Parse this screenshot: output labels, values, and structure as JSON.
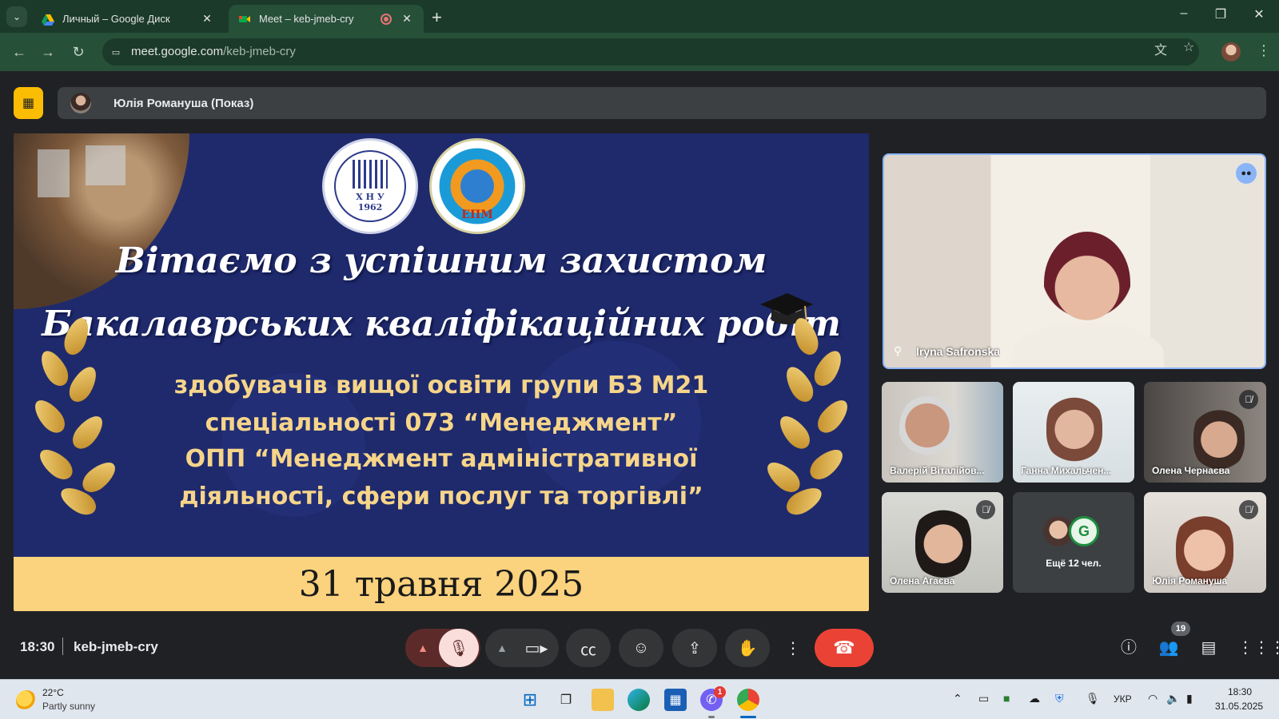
{
  "browser": {
    "tabs": [
      {
        "title": "Личный – Google Диск",
        "favicon": "google-drive-icon",
        "active": false
      },
      {
        "title": "Meet – keb-jmeb-cry",
        "favicon": "google-meet-icon",
        "active": true,
        "recording": true
      }
    ],
    "url_host": "meet.google.com",
    "url_path": "/keb-jmeb-cry",
    "accent": "#265038",
    "tabbar_color": "#1b3a2a"
  },
  "meet": {
    "presenter_label": "Юлія Романуша (Показ)",
    "slide": {
      "title_line1": "Вітаємо з успішним захистом",
      "title_line2": "Бакалаврських кваліфікаційних робіт",
      "sub_line1": "здобувачів вищої освіти групи БЗ М21",
      "sub_line2": "спеціальності 073 “Менеджмент”",
      "sub_line3": "ОПП “Менеджмент адміністративної",
      "sub_line4": "діяльності, сфери послуг та торгівлі”",
      "date": "31 травня 2025",
      "logo1_text": "Х Н У",
      "logo1_year": "1962",
      "logo2_text": "ЕПМ"
    },
    "main_speaker": {
      "name": "Iryna Safronska"
    },
    "participants": [
      {
        "name": "Валерій Віталійов...",
        "muted": false
      },
      {
        "name": "Ганна Михальчен...",
        "muted": false
      },
      {
        "name": "Олена Чернаєва",
        "muted": true
      },
      {
        "name": "Олена Агаєва",
        "muted": true
      },
      {
        "name": "Ещё 12 чел.",
        "muted": false
      },
      {
        "name": "Юлія Романуша",
        "muted": true
      }
    ],
    "time": "18:30",
    "meeting_code": "keb-jmeb-cry",
    "people_count": "19",
    "end_call_color": "#ea4335"
  },
  "taskbar": {
    "weather_temp": "22°C",
    "weather_desc": "Partly sunny",
    "chat_badge": "1",
    "language": "УКР",
    "clock_time": "18:30",
    "clock_date": "31.05.2025"
  }
}
